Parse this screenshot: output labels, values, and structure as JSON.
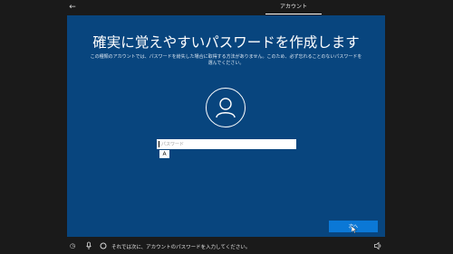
{
  "topbar": {
    "back_icon": "back-arrow-icon",
    "tab_label": "アカウント"
  },
  "main": {
    "title": "確実に覚えやすいパスワードを作成します",
    "subtitle": "この種類のアカウントでは、パスワードを紛失した場合に取得する方法がありません。このため、必ず忘れることのないパスワードを選んでください。",
    "avatar_icon": "user-avatar-icon",
    "password_placeholder": "パスワード",
    "ime_mode": "A",
    "next_label": "次へ"
  },
  "bottombar": {
    "icons": [
      "ease-of-access-icon",
      "microphone-icon",
      "cortana-icon",
      "volume-icon"
    ],
    "status_text": "それでは次に、アカウントのパスワードを入力してください。"
  },
  "colors": {
    "panel_background": "#08457e",
    "frame_background": "#1a1a1a",
    "accent_button": "#0b78d6"
  }
}
